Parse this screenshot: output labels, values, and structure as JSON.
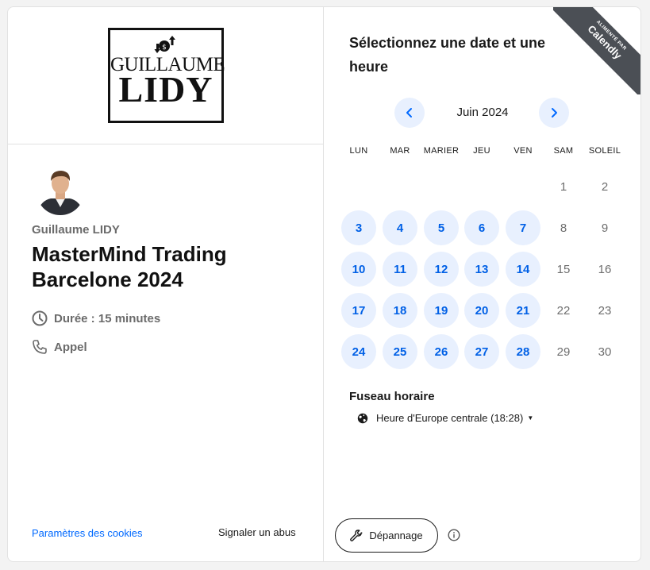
{
  "logo": {
    "line1": "GUILLAUME",
    "line2": "LIDY"
  },
  "host": {
    "name": "Guillaume LIDY"
  },
  "event": {
    "title": "MasterMind Trading Barcelone 2024",
    "duration": "Durée : 15 minutes",
    "location": "Appel"
  },
  "footer": {
    "cookies": "Paramètres des cookies",
    "report": "Signaler un abus"
  },
  "ribbon": {
    "small": "ALIMENTÉ PAR",
    "brand": "Calendly"
  },
  "calendar": {
    "heading": "Sélectionnez une date et une heure",
    "month": "Juin 2024",
    "weekdays": [
      "LUN",
      "MAR",
      "MARIER",
      "JEU",
      "VEN",
      "SAM",
      "SOLEIL"
    ],
    "weeks": [
      [
        null,
        null,
        null,
        null,
        null,
        "1",
        "2"
      ],
      [
        "3",
        "4",
        "5",
        "6",
        "7",
        "8",
        "9"
      ],
      [
        "10",
        "11",
        "12",
        "13",
        "14",
        "15",
        "16"
      ],
      [
        "17",
        "18",
        "19",
        "20",
        "21",
        "22",
        "23"
      ],
      [
        "24",
        "25",
        "26",
        "27",
        "28",
        "29",
        "30"
      ]
    ],
    "available": [
      "3",
      "4",
      "5",
      "6",
      "7",
      "10",
      "11",
      "12",
      "13",
      "14",
      "17",
      "18",
      "19",
      "20",
      "21",
      "24",
      "25",
      "26",
      "27",
      "28"
    ]
  },
  "timezone": {
    "label": "Fuseau horaire",
    "value": "Heure d'Europe centrale (18:28)"
  },
  "troubleshoot": {
    "label": "Dépannage"
  },
  "colors": {
    "accent": "#0069ff",
    "available_bg": "#e8f0fe",
    "ribbon": "#4b4f55"
  }
}
